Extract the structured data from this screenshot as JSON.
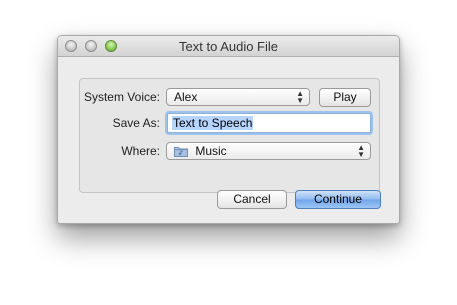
{
  "window": {
    "title": "Text to Audio File"
  },
  "form": {
    "voice_label": "System Voice:",
    "voice_value": "Alex",
    "play_label": "Play",
    "save_as_label": "Save As:",
    "save_as_value": "Text to Speech",
    "where_label": "Where:",
    "where_value": "Music",
    "where_icon": "music-folder-icon"
  },
  "buttons": {
    "cancel_label": "Cancel",
    "continue_label": "Continue"
  },
  "colors": {
    "accent": "#6fa5ea",
    "zoom_button": "#8ccf57",
    "selection": "#b5d5ff"
  }
}
